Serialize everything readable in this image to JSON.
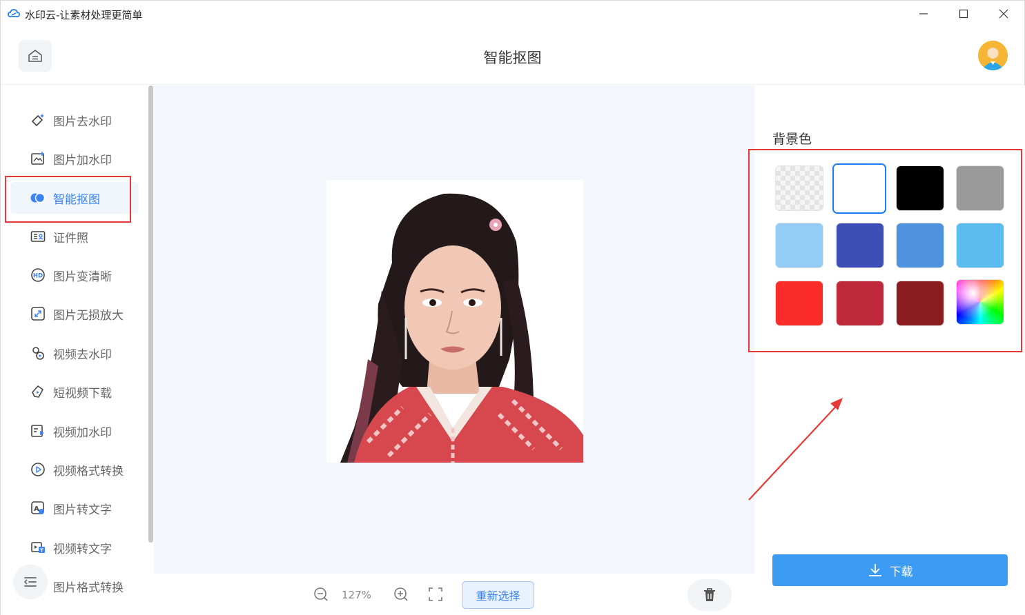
{
  "window": {
    "title": "水印云-让素材处理更简单",
    "controls": [
      "minimize-icon",
      "maximize-icon",
      "close-icon"
    ]
  },
  "header": {
    "title": "智能抠图",
    "home_icon": "home-icon",
    "avatar_icon": "user-avatar"
  },
  "sidebar": {
    "items": [
      {
        "label": "图片去水印",
        "icon": "eraser-icon",
        "active": false
      },
      {
        "label": "图片加水印",
        "icon": "image-add-icon",
        "active": false
      },
      {
        "label": "智能抠图",
        "icon": "cutout-icon",
        "active": true
      },
      {
        "label": "证件照",
        "icon": "id-card-icon",
        "active": false
      },
      {
        "label": "图片变清晰",
        "icon": "hd-icon",
        "active": false
      },
      {
        "label": "图片无损放大",
        "icon": "enlarge-icon",
        "active": false
      },
      {
        "label": "视频去水印",
        "icon": "video-eraser-icon",
        "active": false
      },
      {
        "label": "短视频下载",
        "icon": "video-download-icon",
        "active": false
      },
      {
        "label": "视频加水印",
        "icon": "video-add-icon",
        "active": false
      },
      {
        "label": "视频格式转换",
        "icon": "video-convert-icon",
        "active": false
      },
      {
        "label": "图片转文字",
        "icon": "image-text-icon",
        "active": false
      },
      {
        "label": "视频转文字",
        "icon": "video-text-icon",
        "active": false
      },
      {
        "label": "图片格式转换",
        "icon": "image-convert-icon",
        "active": false
      }
    ],
    "menu_icon": "menu-icon"
  },
  "canvas": {
    "zoom": "127%",
    "reselect_label": "重新选择"
  },
  "right_panel": {
    "background_label": "背景色",
    "swatches": [
      {
        "name": "transparent",
        "color": "transparent"
      },
      {
        "name": "white",
        "color": "#ffffff",
        "selected": true
      },
      {
        "name": "black",
        "color": "#000000"
      },
      {
        "name": "gray",
        "color": "#9a9a9a"
      },
      {
        "name": "light-blue",
        "color": "#93cdf6"
      },
      {
        "name": "royal-blue",
        "color": "#3d4fb7"
      },
      {
        "name": "mid-blue",
        "color": "#4f93de"
      },
      {
        "name": "sky-blue",
        "color": "#5bbcef"
      },
      {
        "name": "red",
        "color": "#fc2c2a"
      },
      {
        "name": "crimson",
        "color": "#c0283c"
      },
      {
        "name": "dark-red",
        "color": "#8b1c1f"
      },
      {
        "name": "custom-picker",
        "color": "spectrum"
      }
    ],
    "download_label": "下载"
  },
  "colors": {
    "accent": "#3a83f1",
    "download_button": "#3c9cf4",
    "annotation_red": "#e53935"
  }
}
